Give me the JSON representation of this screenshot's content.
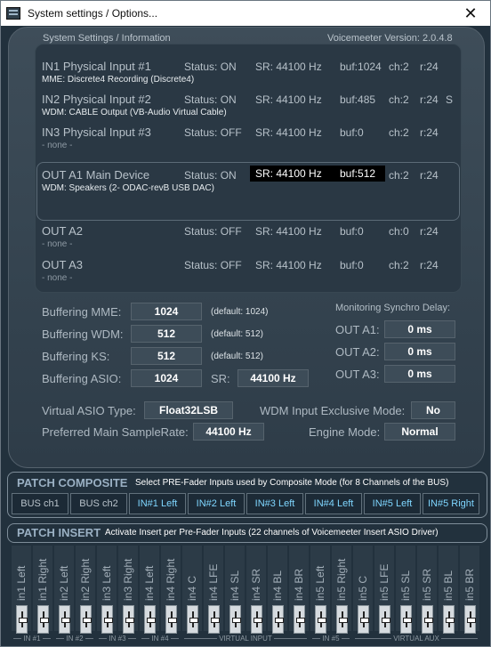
{
  "window": {
    "title": "System settings / Options...",
    "close_glyph": "✕"
  },
  "header": {
    "left": "System Settings / Information",
    "right": "Voicemeeter Version: 2.0.4.8"
  },
  "devices": [
    {
      "name": "IN1 Physical Input #1",
      "status": "Status: ON",
      "sr": "SR: 44100 Hz",
      "buf": "buf:1024",
      "ch": "ch:2",
      "r": "r:24",
      "extra": "",
      "sub": "MME: Discrete4 Recording (Discrete4)"
    },
    {
      "name": "IN2 Physical Input #2",
      "status": "Status: ON",
      "sr": "SR: 44100 Hz",
      "buf": "buf:485",
      "ch": "ch:2",
      "r": "r:24",
      "extra": "S",
      "sub": "WDM: CABLE Output (VB-Audio Virtual Cable)"
    },
    {
      "name": "IN3 Physical Input #3",
      "status": "Status: OFF",
      "sr": "SR: 44100 Hz",
      "buf": "buf:0",
      "ch": "ch:2",
      "r": "r:24",
      "extra": "",
      "sub": "- none -"
    },
    {
      "name": "OUT A1 Main Device",
      "status": "Status: ON",
      "sr": "SR: 44100 Hz",
      "buf": "buf:512",
      "ch": "ch:2",
      "r": "r:24",
      "extra": "",
      "sub": "WDM: Speakers (2- ODAC-revB USB DAC)"
    },
    {
      "name": "OUT A2",
      "status": "Status: OFF",
      "sr": "SR: 44100 Hz",
      "buf": "buf:0",
      "ch": "ch:0",
      "r": "r:24",
      "extra": "",
      "sub": "- none -"
    },
    {
      "name": "OUT A3",
      "status": "Status: OFF",
      "sr": "SR: 44100 Hz",
      "buf": "buf:0",
      "ch": "ch:2",
      "r": "r:24",
      "extra": "",
      "sub": "- none -"
    }
  ],
  "buffering": {
    "mme": {
      "label": "Buffering MME:",
      "value": "1024",
      "default": "(default: 1024)"
    },
    "wdm": {
      "label": "Buffering WDM:",
      "value": "512",
      "default": "(default: 512)"
    },
    "ks": {
      "label": "Buffering KS:",
      "value": "512",
      "default": "(default: 512)"
    },
    "asio": {
      "label": "Buffering ASIO:",
      "value": "1024",
      "sr_label": "SR:",
      "sr_value": "44100 Hz"
    }
  },
  "monitoring": {
    "title": "Monitoring Synchro Delay:",
    "a1": {
      "label": "OUT A1:",
      "value": "0 ms"
    },
    "a2": {
      "label": "OUT A2:",
      "value": "0 ms"
    },
    "a3": {
      "label": "OUT A3:",
      "value": "0 ms"
    }
  },
  "options": {
    "asio_type_label": "Virtual ASIO Type:",
    "asio_type_value": "Float32LSB",
    "wdm_exclusive_label": "WDM Input Exclusive Mode:",
    "wdm_exclusive_value": "No",
    "samplerate_label": "Preferred Main SampleRate:",
    "samplerate_value": "44100 Hz",
    "engine_label": "Engine Mode:",
    "engine_value": "Normal"
  },
  "patch_composite": {
    "title": "PATCH COMPOSITE",
    "description": "Select PRE-Fader Inputs used by Composite Mode (for 8 Channels of the BUS)",
    "buttons": [
      "BUS ch1",
      "BUS ch2",
      "IN#1 Left",
      "IN#2 Left",
      "IN#3 Left",
      "IN#4 Left",
      "IN#5 Left",
      "IN#5 Right"
    ]
  },
  "patch_insert": {
    "title": "PATCH INSERT",
    "description": "Activate Insert per Pre-Fader Inputs (22 channels of Voicemeeter Insert ASIO Driver)",
    "channels": [
      "in1 Left",
      "in1 Right",
      "in2 Left",
      "in2 Right",
      "in3 Left",
      "in3 Right",
      "in4 Left",
      "in4 Right",
      "in4 C",
      "in4 LFE",
      "in4 SL",
      "in4 SR",
      "in4 BL",
      "in4 BR",
      "in5 Left",
      "in5 Right",
      "in5 C",
      "in5 LFE",
      "in5 SL",
      "in5 SR",
      "in5 BL",
      "in5 BR"
    ],
    "groups": [
      "IN #1",
      "IN #2",
      "IN #3",
      "IN #4",
      "VIRTUAL INPUT",
      "IN #5",
      "VIRTUAL AUX"
    ]
  },
  "colors": {
    "accent_blue": "#7fd6ff",
    "grey_button_text": "#b9c3cb",
    "panel_bg": "#3a4955"
  }
}
